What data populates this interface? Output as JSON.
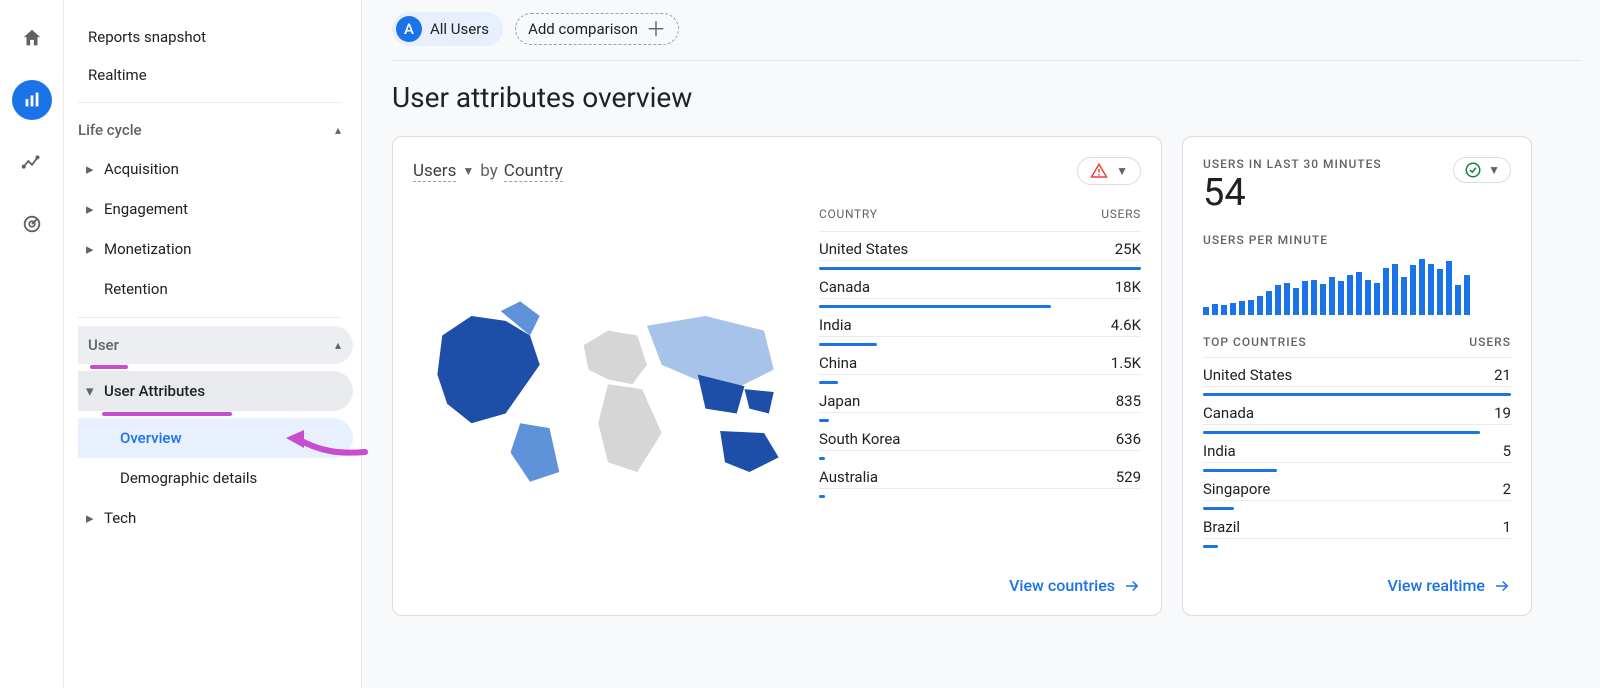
{
  "rail": {
    "home": "home-icon",
    "reports": "reports-icon",
    "explore": "explore-icon",
    "advertising": "advertising-icon"
  },
  "sidebar": {
    "reportsSnapshot": "Reports snapshot",
    "realtime": "Realtime",
    "lifeCycle": {
      "label": "Life cycle",
      "items": [
        {
          "label": "Acquisition"
        },
        {
          "label": "Engagement"
        },
        {
          "label": "Monetization"
        },
        {
          "label": "Retention"
        }
      ]
    },
    "user": {
      "label": "User",
      "userAttributes": {
        "label": "User Attributes",
        "items": [
          {
            "label": "Overview",
            "active": true
          },
          {
            "label": "Demographic details"
          }
        ]
      },
      "tech": {
        "label": "Tech"
      }
    }
  },
  "comparison": {
    "badgeLetter": "A",
    "allUsers": "All Users",
    "addComparison": "Add comparison"
  },
  "page": {
    "title": "User attributes overview"
  },
  "mapCard": {
    "metric": "Users",
    "by": "by",
    "dimension": "Country",
    "headCountry": "COUNTRY",
    "headUsers": "USERS",
    "rows": [
      {
        "country": "United States",
        "users": "25K",
        "pct": 100
      },
      {
        "country": "Canada",
        "users": "18K",
        "pct": 72
      },
      {
        "country": "India",
        "users": "4.6K",
        "pct": 18
      },
      {
        "country": "China",
        "users": "1.5K",
        "pct": 6
      },
      {
        "country": "Japan",
        "users": "835",
        "pct": 3
      },
      {
        "country": "South Korea",
        "users": "636",
        "pct": 2
      },
      {
        "country": "Australia",
        "users": "529",
        "pct": 2
      }
    ],
    "viewLink": "View countries"
  },
  "realtime": {
    "label": "USERS IN LAST 30 MINUTES",
    "value": "54",
    "perMinuteLabel": "USERS PER MINUTE",
    "topLabel": "TOP COUNTRIES",
    "usersHead": "USERS",
    "spark": [
      6,
      8,
      7,
      9,
      10,
      11,
      14,
      18,
      22,
      24,
      20,
      25,
      26,
      23,
      28,
      25,
      30,
      32,
      26,
      24,
      35,
      38,
      28,
      37,
      42,
      38,
      34,
      40,
      22,
      30
    ],
    "rows": [
      {
        "country": "United States",
        "users": "21",
        "pct": 100
      },
      {
        "country": "Canada",
        "users": "19",
        "pct": 90
      },
      {
        "country": "India",
        "users": "5",
        "pct": 24
      },
      {
        "country": "Singapore",
        "users": "2",
        "pct": 10
      },
      {
        "country": "Brazil",
        "users": "1",
        "pct": 5
      }
    ],
    "viewLink": "View realtime"
  },
  "chart_data": [
    {
      "type": "bar",
      "title": "Users by Country",
      "categories": [
        "United States",
        "Canada",
        "India",
        "China",
        "Japan",
        "South Korea",
        "Australia"
      ],
      "values": [
        25000,
        18000,
        4600,
        1500,
        835,
        636,
        529
      ],
      "xlabel": "Country",
      "ylabel": "Users"
    },
    {
      "type": "bar",
      "title": "Users per minute (last 30)",
      "categories": [
        1,
        2,
        3,
        4,
        5,
        6,
        7,
        8,
        9,
        10,
        11,
        12,
        13,
        14,
        15,
        16,
        17,
        18,
        19,
        20,
        21,
        22,
        23,
        24,
        25,
        26,
        27,
        28,
        29,
        30
      ],
      "values": [
        6,
        8,
        7,
        9,
        10,
        11,
        14,
        18,
        22,
        24,
        20,
        25,
        26,
        23,
        28,
        25,
        30,
        32,
        26,
        24,
        35,
        38,
        28,
        37,
        42,
        38,
        34,
        40,
        22,
        30
      ],
      "xlabel": "Minute",
      "ylabel": "Users"
    }
  ]
}
